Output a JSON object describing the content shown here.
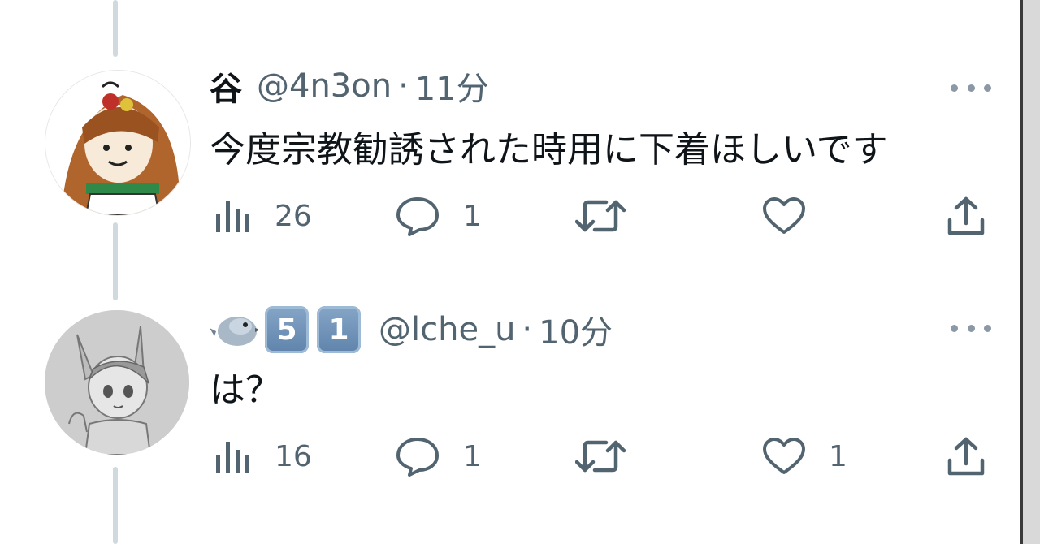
{
  "tweets": [
    {
      "display_name": "谷",
      "handle": "@4n3on",
      "separator": "·",
      "time": "11分",
      "text": "今度宗教勧誘された時用に下着ほしいです",
      "avatar_icon": "anime-avatar-illustration",
      "stats": {
        "views": "26",
        "replies": "1",
        "retweets": "",
        "likes": "",
        "share": ""
      }
    },
    {
      "display_name_emoji": [
        "bird-emoji",
        "keycap-5",
        "keycap-1"
      ],
      "keycap_5": "5",
      "keycap_1": "1",
      "handle": "@lche_u",
      "separator": "·",
      "time": "10分",
      "text": "は？",
      "avatar_icon": "pencil-sketch-avatar",
      "stats": {
        "views": "16",
        "replies": "1",
        "retweets": "",
        "likes": "1",
        "share": ""
      }
    }
  ],
  "colors": {
    "text_primary": "#0f1419",
    "text_secondary": "#536471",
    "thread_line": "#cfd9de",
    "icon": "#536471"
  }
}
